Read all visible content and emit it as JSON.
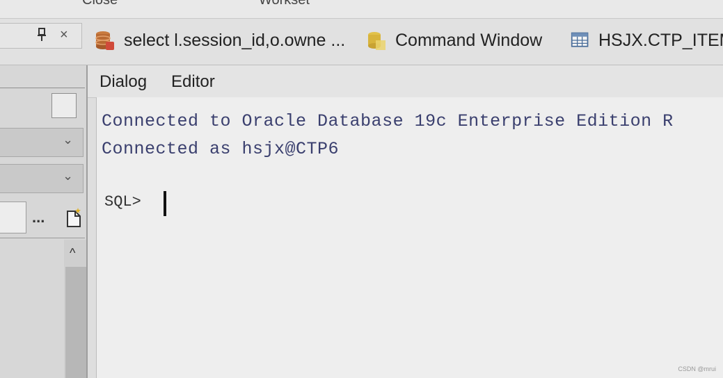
{
  "menu": {
    "items": [
      "Close",
      "Workset"
    ]
  },
  "left_tab": {
    "pin_icon": "pin-icon",
    "close_icon": "close-icon",
    "close_glyph": "×"
  },
  "tabs": [
    {
      "label": "select l.session_id,o.owne ...",
      "icon": "database-icon"
    },
    {
      "label": "Command Window",
      "icon": "command-window-icon"
    },
    {
      "label": "HSJX.CTP_ITEM",
      "icon": "table-icon"
    }
  ],
  "subtabs": [
    "Dialog",
    "Editor"
  ],
  "left_panel": {
    "ellipsis": "...",
    "scroll_up_glyph": "^",
    "combo_glyph": "⌄"
  },
  "console": {
    "lines": [
      "Connected to Oracle Database 19c Enterprise Edition R",
      "Connected as hsjx@CTP6"
    ],
    "prompt": "SQL>"
  },
  "watermark": "CSDN @mrui",
  "colors": {
    "console_text": "#3a3f6e",
    "console_bg": "#eeeeee",
    "tabbar_bg": "#e1e1e1"
  }
}
